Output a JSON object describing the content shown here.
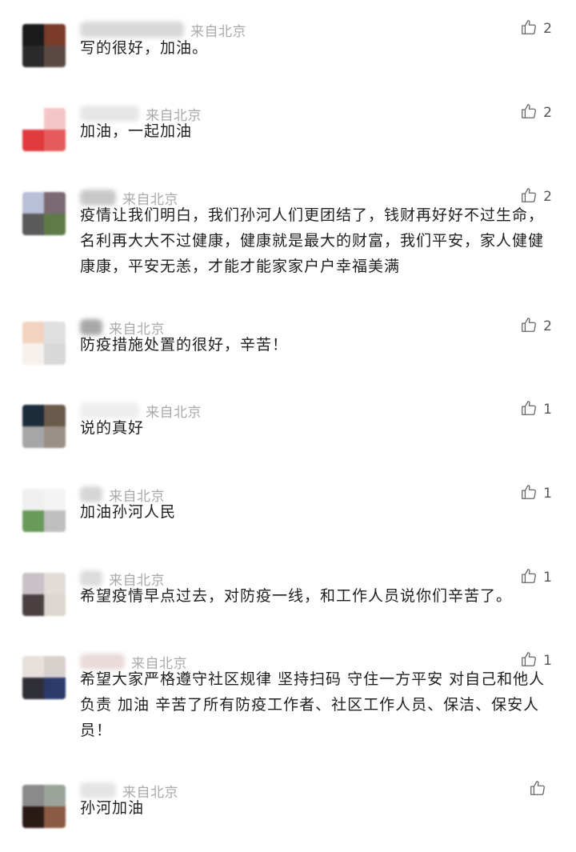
{
  "comments": [
    {
      "location": "来自北京",
      "content": "写的很好，加油。",
      "likes": "2",
      "avatar_colors": [
        "#1a1a1a",
        "#7a3b2a",
        "#2a2a2a",
        "#5b4a44"
      ],
      "name_color": "#d8d8d8"
    },
    {
      "location": "来自北京",
      "content": "加油，一起加油",
      "likes": "2",
      "avatar_colors": [
        "#ffffff",
        "#f4c6c6",
        "#e03a3e",
        "#e55b5b"
      ],
      "name_color": "#e6e6e6"
    },
    {
      "location": "来自北京",
      "content": "疫情让我们明白，我们孙河人们更团结了，钱财再好好不过生命，名利再大大不过健康，健康就是最大的财富，我们平安，家人健健康康，平安无恙，才能才能家家户户幸福美满",
      "likes": "2",
      "avatar_colors": [
        "#b9bfd6",
        "#7a6a72",
        "#5a5a5a",
        "#5e7a48"
      ],
      "name_color": "#c8c8c8"
    },
    {
      "location": "来自北京",
      "content": "防疫措施处置的很好，辛苦！",
      "likes": "2",
      "avatar_colors": [
        "#f2d3c0",
        "#e0e0e0",
        "#f6f1ec",
        "#d8d8d8"
      ],
      "name_color": "#a8a8a8"
    },
    {
      "location": "来自北京",
      "content": "说的真好",
      "likes": "1",
      "avatar_colors": [
        "#1d2c3a",
        "#6a5a4c",
        "#a6a6a6",
        "#9a8f86"
      ],
      "name_color": "#eeeeee"
    },
    {
      "location": "来自北京",
      "content": "加油孙河人民",
      "likes": "1",
      "avatar_colors": [
        "#f0f0f0",
        "#f4f4f4",
        "#6a9a5a",
        "#bfbfbf"
      ],
      "name_color": "#d6d6d6"
    },
    {
      "location": "来自北京",
      "content": "希望疫情早点过去，对防疫一线，和工作人员说你们辛苦了。",
      "likes": "1",
      "avatar_colors": [
        "#c9c0c8",
        "#e2dcd8",
        "#4a4042",
        "#dcd6d0"
      ],
      "name_color": "#dcdcdc"
    },
    {
      "location": "来自北京",
      "content": "希望大家严格遵守社区规律 坚持扫码 守住一方平安 对自己和他人负责 加油 辛苦了所有防疫工作者、社区工作人员、保洁、保安人员！",
      "likes": "1",
      "avatar_colors": [
        "#e8e0dc",
        "#d8d0cc",
        "#2f2f38",
        "#2a3a6a"
      ],
      "name_color": "#eadada"
    },
    {
      "location": "来自北京",
      "content": "孙河加油",
      "likes": "",
      "avatar_colors": [
        "#8a8a8a",
        "#9aa49a",
        "#2a1a16",
        "#8a5a44"
      ],
      "name_color": "#e4e4e4"
    }
  ]
}
